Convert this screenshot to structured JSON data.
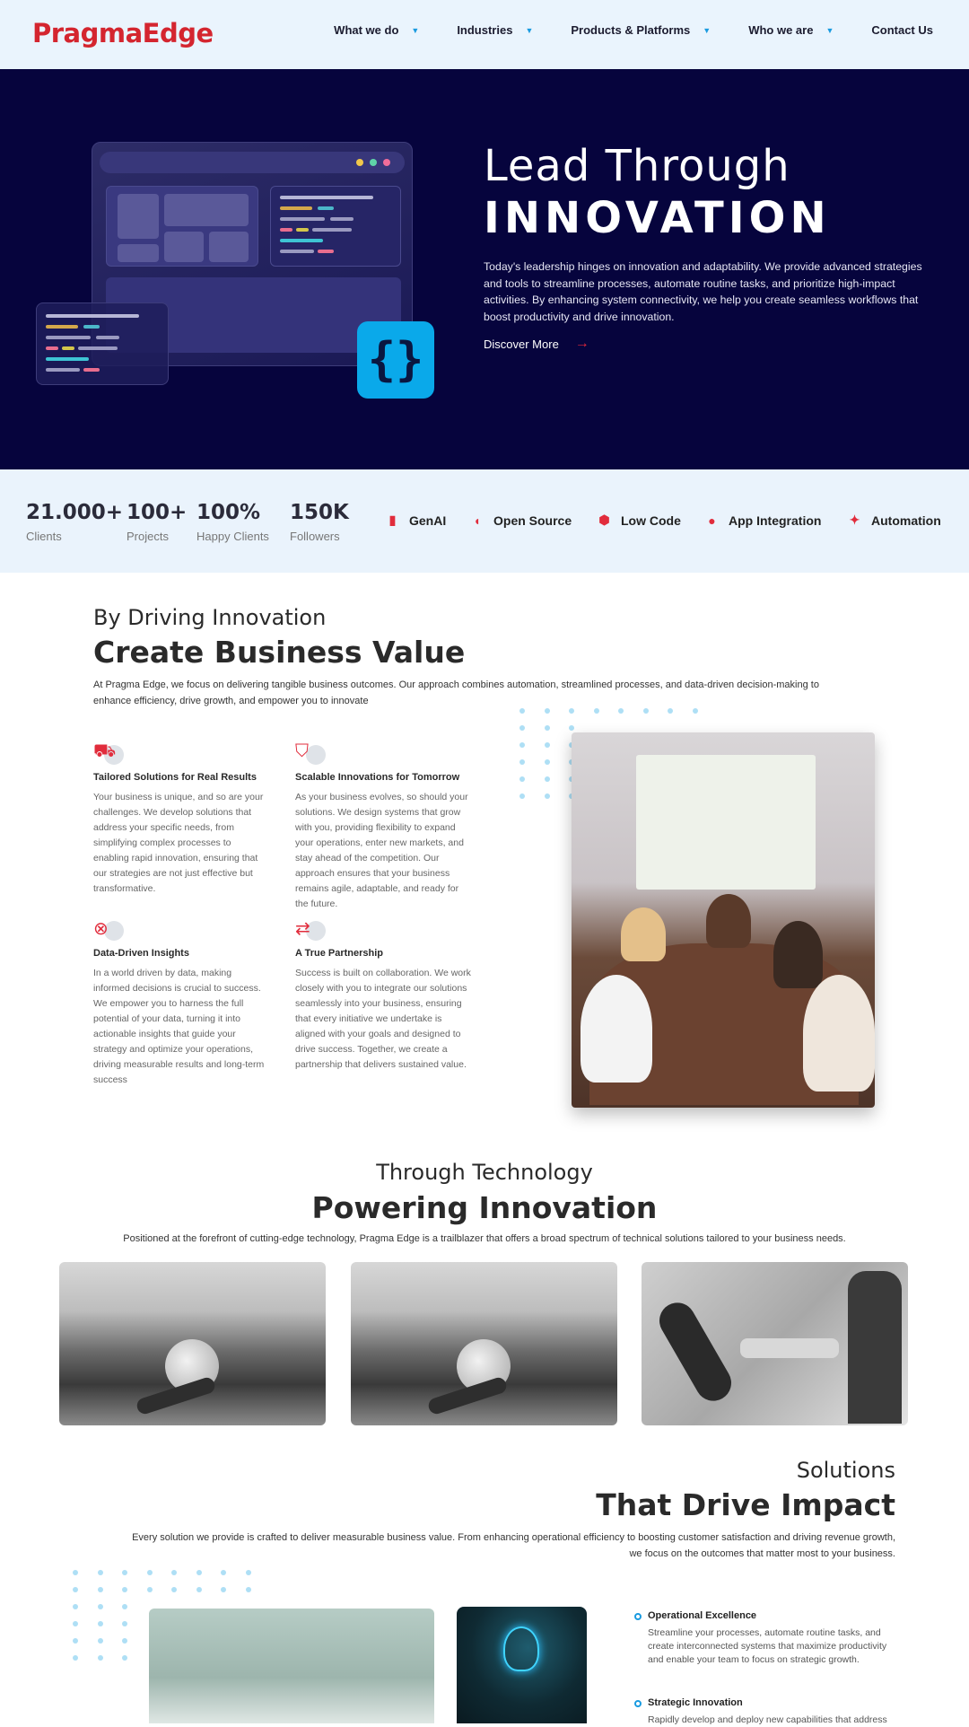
{
  "header": {
    "logo": "PragmaEdge",
    "nav": [
      {
        "label": "What we do",
        "has_dropdown": true
      },
      {
        "label": "Industries",
        "has_dropdown": true
      },
      {
        "label": "Products & Platforms",
        "has_dropdown": true
      },
      {
        "label": "Who we are",
        "has_dropdown": true
      },
      {
        "label": "Contact Us",
        "has_dropdown": false
      }
    ]
  },
  "hero": {
    "title_line1": "Lead Through",
    "title_line2": "INNOVATION",
    "description": "Today's leadership hinges on innovation and adaptability. We provide advanced strategies and tools to streamline processes, automate routine tasks, and prioritize high-impact activities. By enhancing system connectivity, we help you create seamless workflows that boost productivity and drive innovation.",
    "cta_label": "Discover More",
    "code_icon": "{}",
    "colors": {
      "background": "#06043d",
      "accent": "#0aa9ea",
      "arrow": "#e3283a"
    }
  },
  "stats": [
    {
      "value": "21.000+",
      "label": "Clients"
    },
    {
      "value": "100+",
      "label": "Projects"
    },
    {
      "value": "100%",
      "label": "Happy Clients"
    },
    {
      "value": "150K",
      "label": "Followers"
    }
  ],
  "technologies": [
    {
      "label": "GenAI",
      "icon": "genai-icon"
    },
    {
      "label": "Open Source",
      "icon": "open-source-icon"
    },
    {
      "label": "Low Code",
      "icon": "low-code-icon"
    },
    {
      "label": "App Integration",
      "icon": "app-integration-icon"
    },
    {
      "label": "Automation",
      "icon": "automation-icon"
    }
  ],
  "business_value": {
    "subtitle": "By Driving Innovation",
    "title": "Create Business Value",
    "description": "At Pragma Edge, we focus on delivering tangible business outcomes. Our approach combines automation, streamlined processes, and data-driven decision-making to enhance efficiency, drive growth, and empower you to innovate",
    "features": [
      {
        "icon": "truck-icon",
        "title": "Tailored Solutions for Real Results",
        "text": "Your business is unique, and so are your challenges. We develop solutions that address your specific needs, from simplifying complex processes to enabling rapid innovation, ensuring that our strategies are not just effective but transformative."
      },
      {
        "icon": "shopping-bag-icon",
        "title": "Scalable Innovations for Tomorrow",
        "text": "As your business evolves, so should your solutions. We design systems that grow with you, providing flexibility to expand your operations, enter new markets, and stay ahead of the competition. Our approach ensures that your business remains agile, adaptable, and ready for the future."
      },
      {
        "icon": "lifebuoy-icon",
        "title": "Data-Driven Insights",
        "text": "In a world driven by data, making informed decisions is crucial to success. We empower you to harness the full potential of your data, turning it into actionable insights that guide your strategy and optimize your operations, driving measurable results and long-term success"
      },
      {
        "icon": "repeat-icon",
        "title": "A True Partnership",
        "text": "Success is built on collaboration. We work closely with you to integrate our solutions seamlessly into your business, ensuring that every initiative we undertake is aligned with your goals and designed to drive success. Together, we create a partnership that delivers sustained value."
      }
    ]
  },
  "powering": {
    "subtitle": "Through Technology",
    "title": "Powering Innovation",
    "description": "Positioned at the forefront of cutting-edge technology, Pragma Edge is a trailblazer that offers a broad spectrum of technical solutions tailored to your business needs."
  },
  "solutions": {
    "subtitle": "Solutions",
    "title": "That Drive Impact",
    "description": "Every solution we provide is crafted to deliver measurable business value. From enhancing operational efficiency to boosting customer satisfaction and driving revenue growth, we focus on the outcomes that matter most to your business.",
    "items": [
      {
        "title": "Operational Excellence",
        "text": "Streamline your processes, automate routine tasks, and create interconnected systems that maximize productivity and enable your team to focus on strategic growth."
      },
      {
        "title": "Strategic Innovation",
        "text": "Rapidly develop and deploy new capabilities that address"
      }
    ]
  }
}
